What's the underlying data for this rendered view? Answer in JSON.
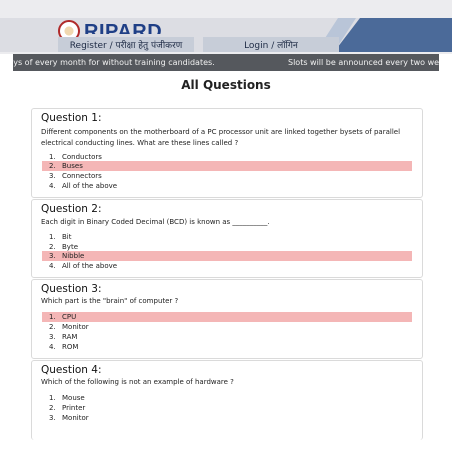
{
  "header": {
    "brand": "RIPARD",
    "register_label": "Register / परीक्षा हेतु पंजीकरण",
    "login_label": "Login / लॉगिन"
  },
  "ticker": {
    "text_left": "aturdays of every month for without training candidates.",
    "text_right": "Slots will be announced every two wee"
  },
  "main": {
    "title": "All Questions",
    "questions": [
      {
        "title": "Question 1:",
        "text": "Different components on the motherboard of a PC processor unit are linked together bysets of parallel electrical conducting lines. What are these lines called ?",
        "options": [
          {
            "num": "1.",
            "label": "Conductors"
          },
          {
            "num": "2.",
            "label": "Buses"
          },
          {
            "num": "3.",
            "label": "Connectors"
          },
          {
            "num": "4.",
            "label": "All of the above"
          }
        ],
        "correct_option": 2
      },
      {
        "title": "Question 2:",
        "text": "Each digit in Binary Coded Decimal (BCD) is known as __________.",
        "options": [
          {
            "num": "1.",
            "label": "Bit"
          },
          {
            "num": "2.",
            "label": "Byte"
          },
          {
            "num": "3.",
            "label": "Nibble"
          },
          {
            "num": "4.",
            "label": "All of the above"
          }
        ],
        "correct_option": 3
      },
      {
        "title": "Question 3:",
        "text": "Which part is the \"brain\" of computer ?",
        "options": [
          {
            "num": "1.",
            "label": "CPU"
          },
          {
            "num": "2.",
            "label": "Monitor"
          },
          {
            "num": "3.",
            "label": "RAM"
          },
          {
            "num": "4.",
            "label": "ROM"
          }
        ],
        "correct_option": 1
      },
      {
        "title": "Question 4:",
        "text": "Which of the following is not an example of hardware ?",
        "options": [
          {
            "num": "1.",
            "label": "Mouse"
          },
          {
            "num": "2.",
            "label": "Printer"
          },
          {
            "num": "3.",
            "label": "Monitor"
          }
        ]
      }
    ]
  },
  "colors": {
    "correct_highlight": "#f4b6b6",
    "ticker_bg": "#55585d",
    "brand": "#1f3f86"
  }
}
